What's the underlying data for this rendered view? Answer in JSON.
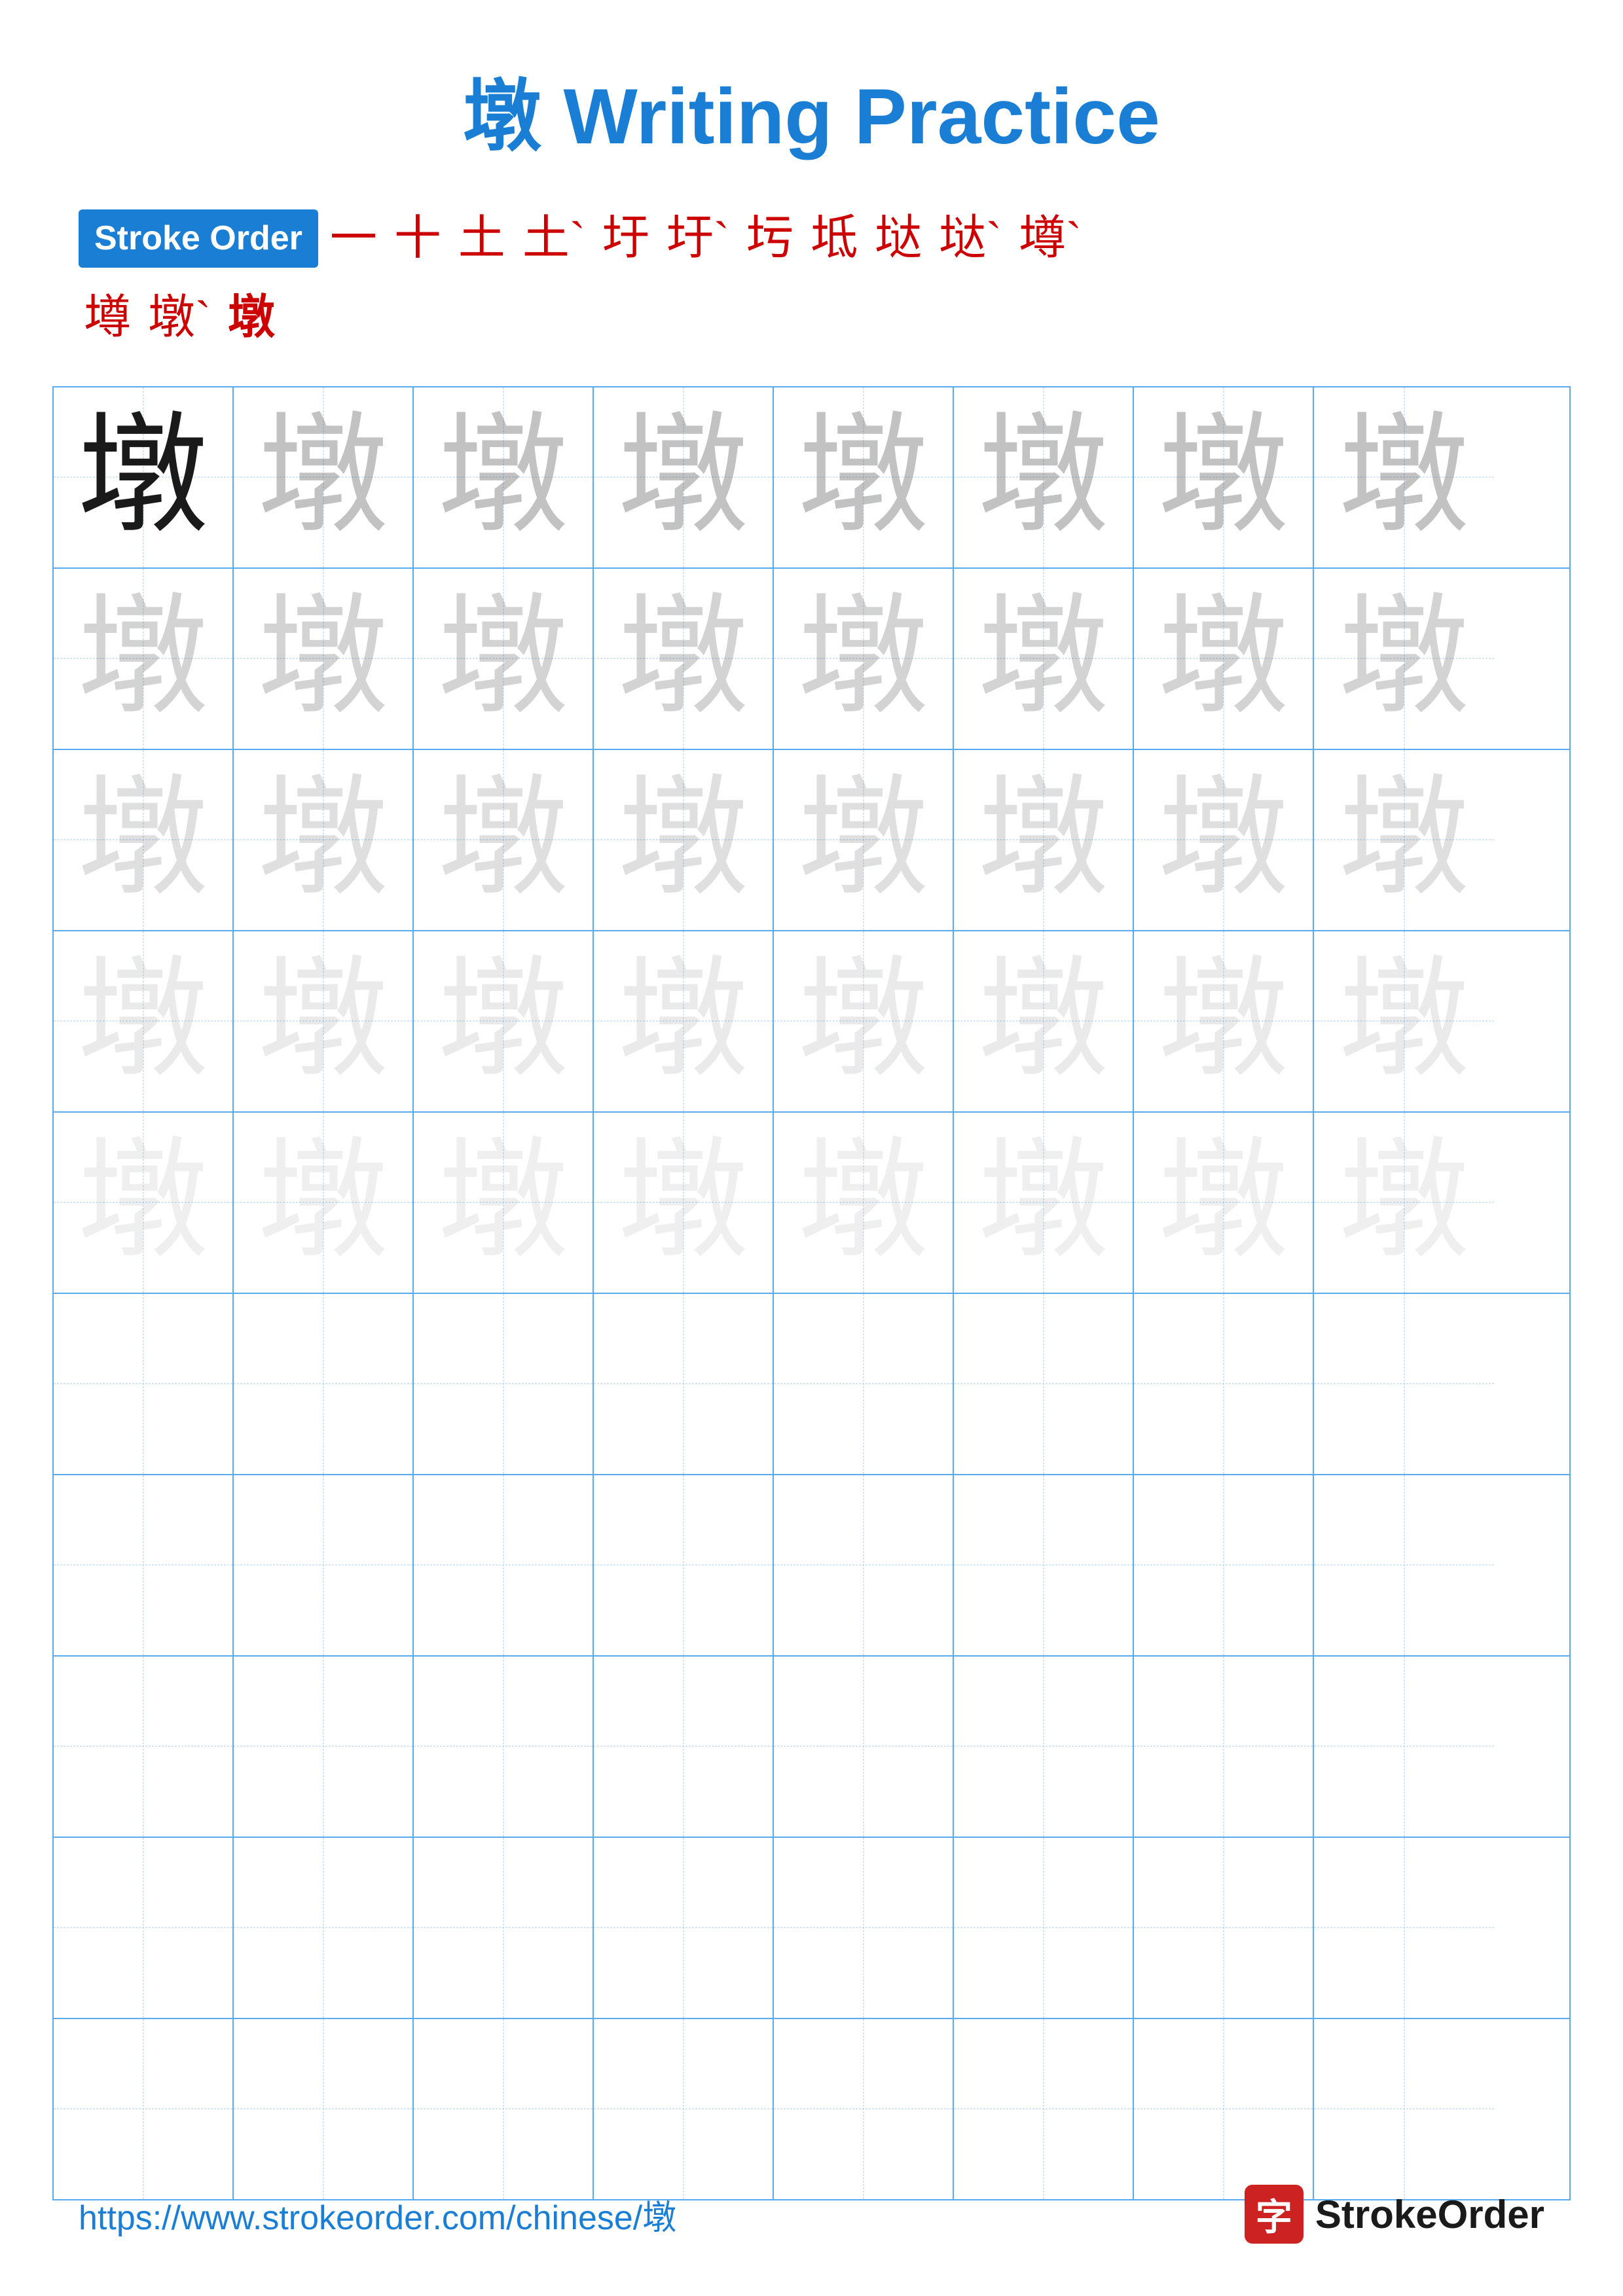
{
  "title": {
    "char": "墩",
    "text": "墩 Writing Practice"
  },
  "stroke_order": {
    "badge_label": "Stroke Order",
    "chars_row1": [
      "一",
      "十",
      "土",
      "土`",
      "圩",
      "圩`",
      "圬",
      "坻",
      "垯",
      "垯`",
      "墫`"
    ],
    "chars_row2": [
      "墫",
      "墩`",
      "墩"
    ]
  },
  "practice_char": "墩",
  "grid": {
    "rows": 10,
    "cols": 8
  },
  "footer": {
    "url": "https://www.strokeorder.com/chinese/墩",
    "logo_char": "字",
    "logo_text": "StrokeOrder"
  }
}
